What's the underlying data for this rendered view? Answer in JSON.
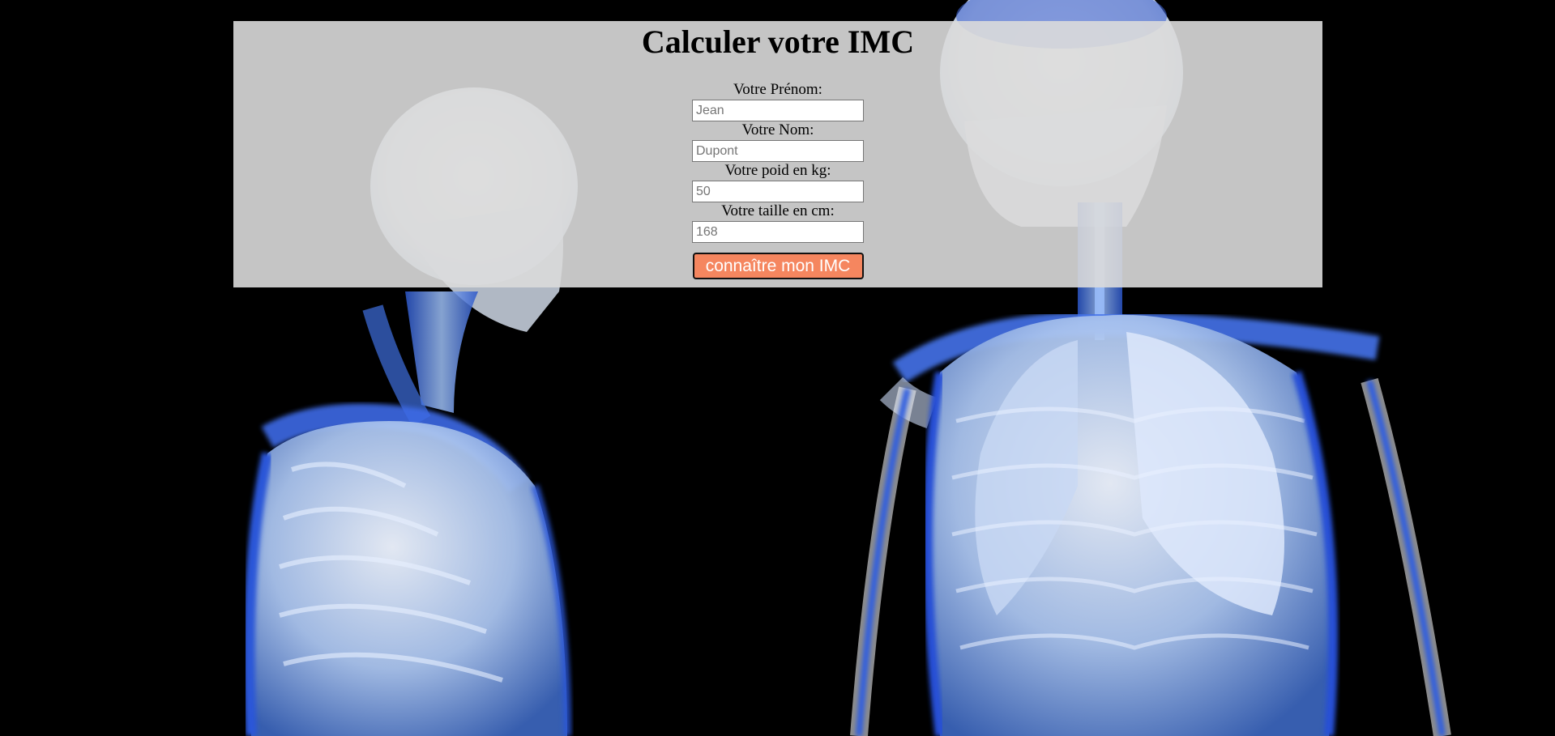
{
  "page": {
    "title": "Calculer votre IMC"
  },
  "form": {
    "prenom": {
      "label": "Votre Prénom:",
      "placeholder": "Jean"
    },
    "nom": {
      "label": "Votre Nom:",
      "placeholder": "Dupont"
    },
    "poids": {
      "label": "Votre poid en kg:",
      "placeholder": "50"
    },
    "taille": {
      "label": "Votre taille en cm:",
      "placeholder": "168"
    },
    "submit_label": "connaître mon IMC"
  },
  "colors": {
    "page_background": "#000000",
    "panel_background": "#dadada",
    "button_background": "#f5865f",
    "button_text": "#ffffff",
    "skeleton_blue": "#5a8ee8"
  },
  "background": {
    "description_icon": "anatomy-skeletons-illustration"
  }
}
